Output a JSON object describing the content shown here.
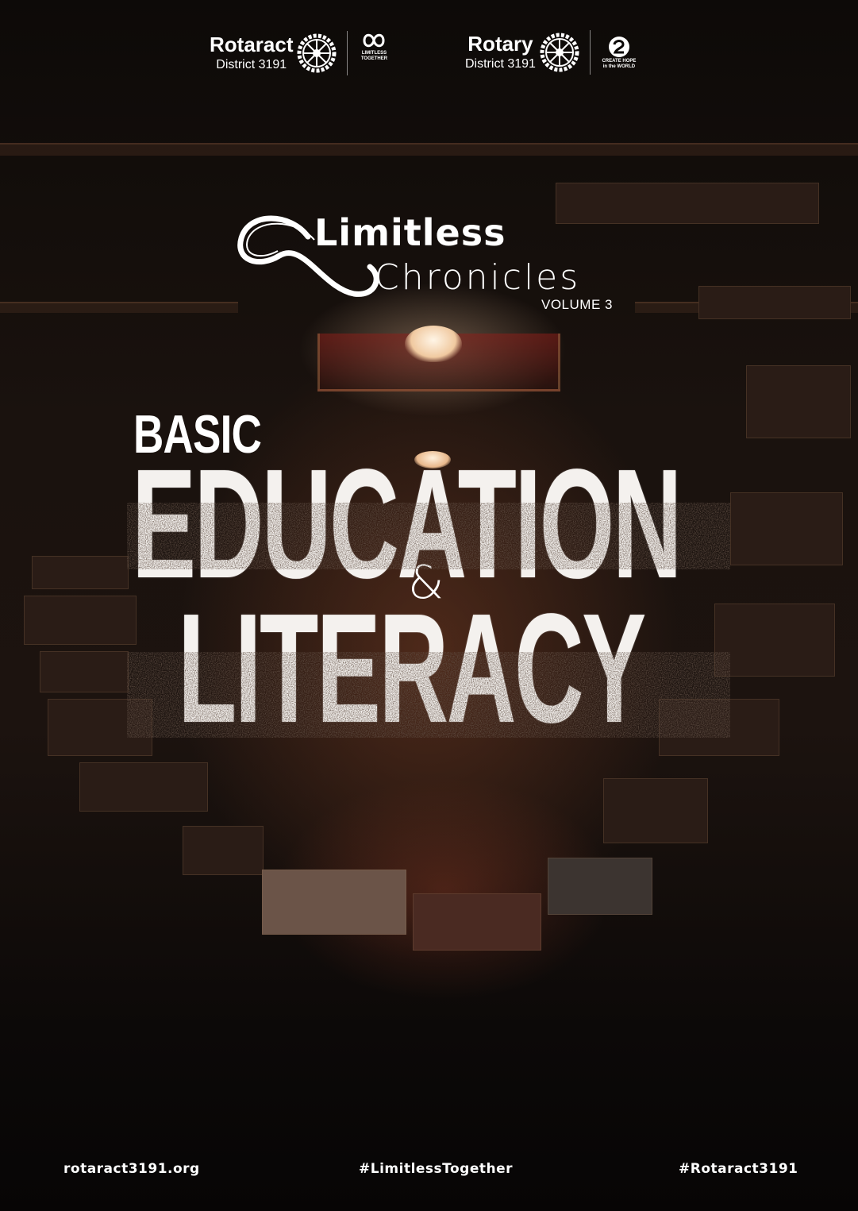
{
  "header": {
    "rotaract": {
      "name": "Rotaract",
      "district": "District 3191"
    },
    "limitless_badge": {
      "line1": "LIMITLESS",
      "line2": "TOGETHER"
    },
    "rotary": {
      "name": "Rotary",
      "district": "District 3191"
    },
    "hope_badge": {
      "line1": "CREATE HOPE",
      "line2": "in the WORLD"
    }
  },
  "masthead": {
    "title_top": "Limitless",
    "title_bottom": "Chronicles",
    "volume": "VOLUME 3"
  },
  "cover": {
    "kicker": "BASIC",
    "line1": "EDUCATION",
    "ampersand": "&",
    "line2": "LITERACY"
  },
  "footer": {
    "website": "rotaract3191.org",
    "hashtag_primary": "#LimitlessTogether",
    "hashtag_secondary": "#Rotaract3191"
  },
  "colors": {
    "background": "#0b0807",
    "text": "#ffffff",
    "warm_glow": "#c07a50"
  },
  "icons": [
    "rotary-wheel-icon",
    "infinity-icon",
    "hope-icon"
  ]
}
